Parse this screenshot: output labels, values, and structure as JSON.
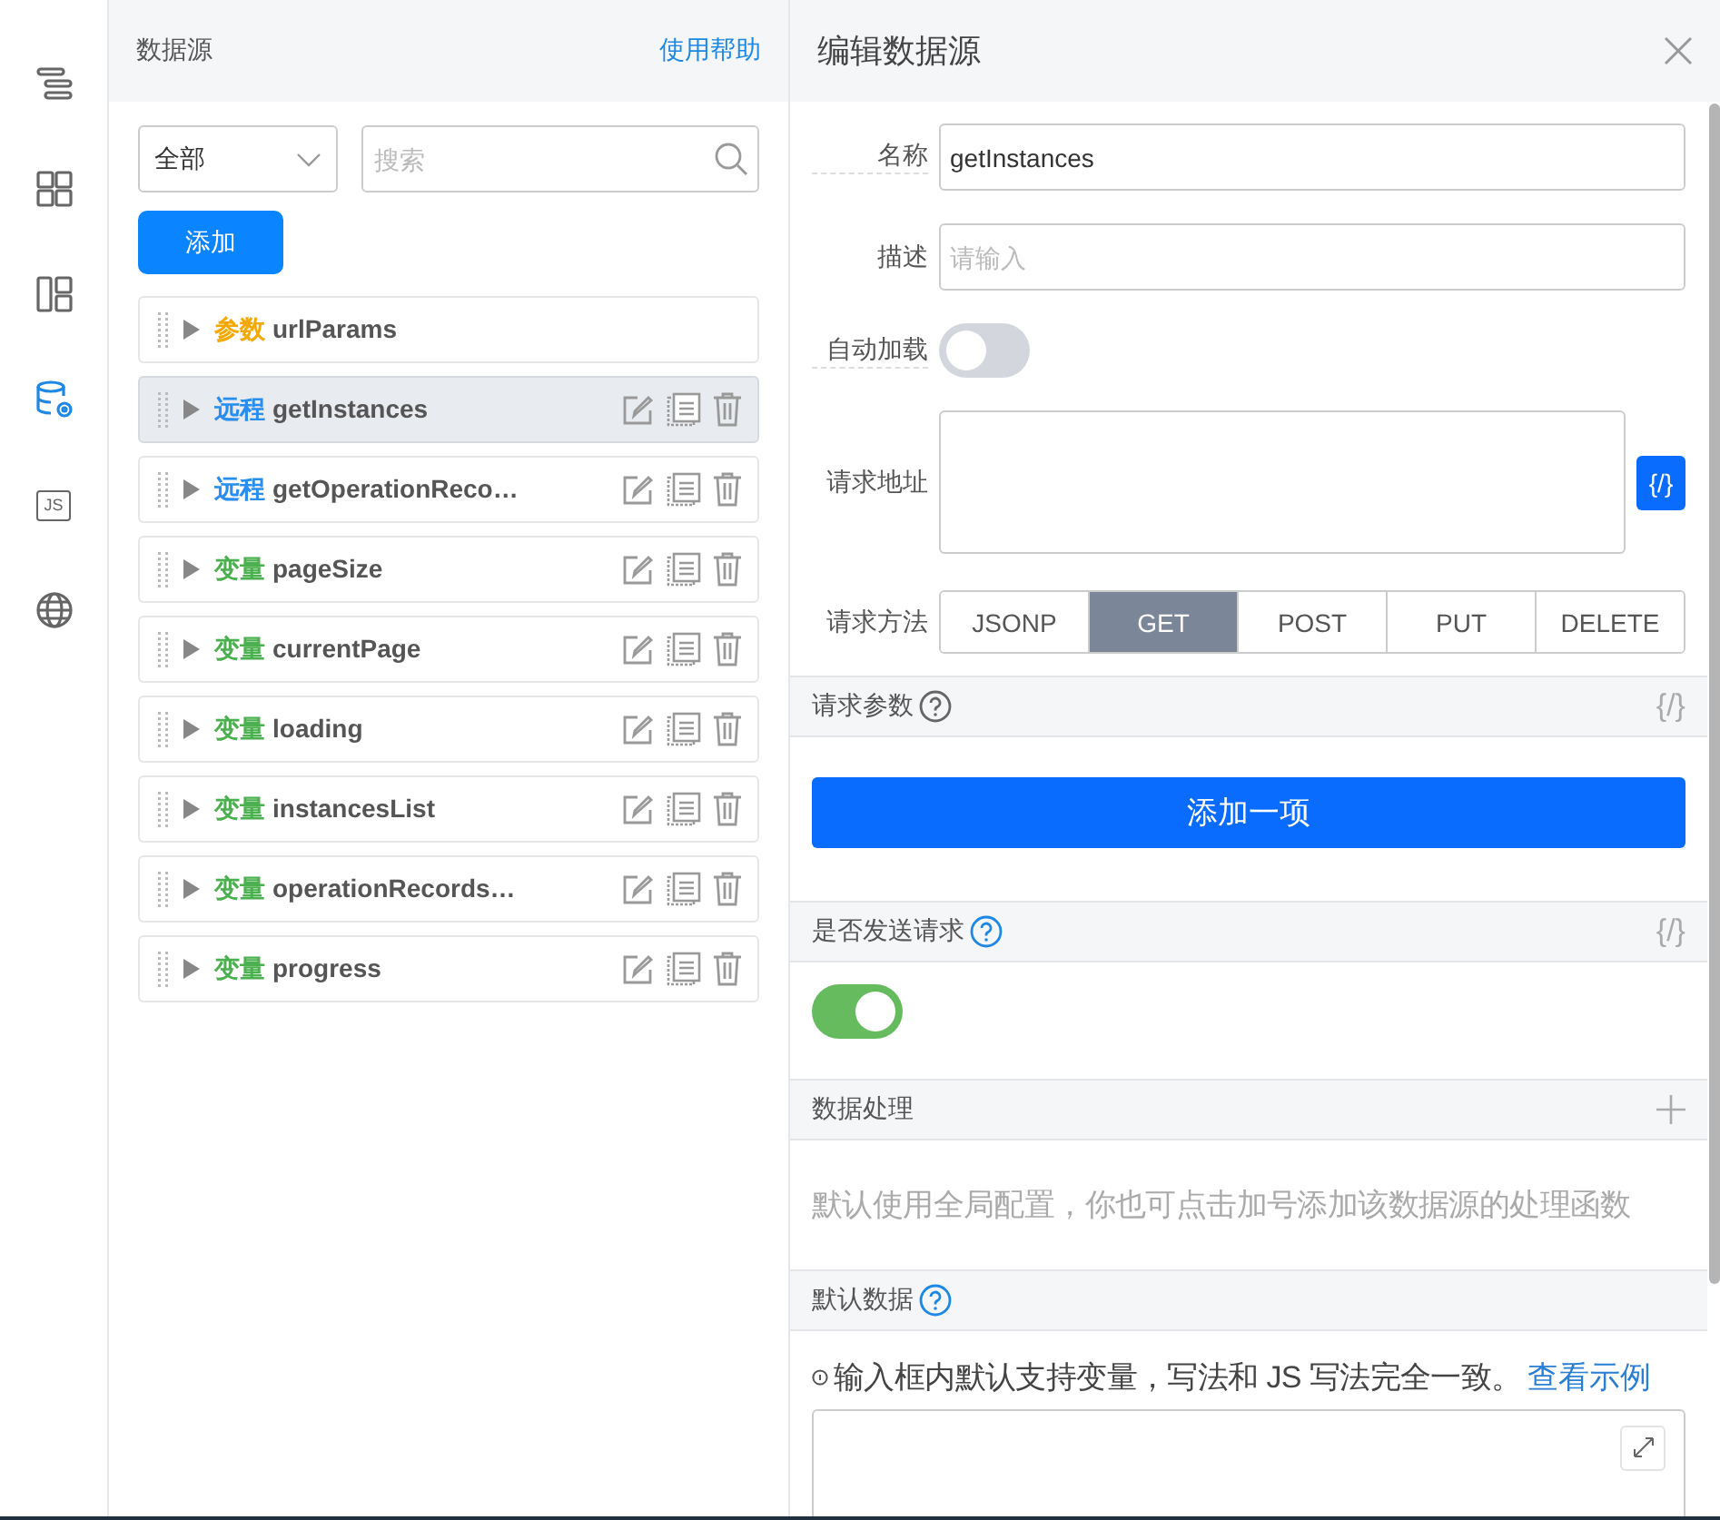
{
  "rail": [
    {
      "kind": "outline",
      "selected": false
    },
    {
      "kind": "grid",
      "selected": false
    },
    {
      "kind": "layout",
      "selected": false
    },
    {
      "kind": "database",
      "selected": true
    },
    {
      "kind": "js",
      "label": "JS",
      "selected": false
    },
    {
      "kind": "globe",
      "selected": false
    }
  ],
  "list_panel": {
    "title": "数据源",
    "help_link": "使用帮助",
    "filter": "全部",
    "search_placeholder": "搜索",
    "add_button": "添加",
    "items": [
      {
        "kind": "param",
        "tag": "参数",
        "name": "urlParams",
        "selected": false,
        "editable": false
      },
      {
        "kind": "remote",
        "tag": "远程",
        "name": "getInstances",
        "selected": true,
        "editable": true
      },
      {
        "kind": "remote",
        "tag": "远程",
        "name": "getOperationReco…",
        "selected": false,
        "editable": true
      },
      {
        "kind": "variable",
        "tag": "变量",
        "name": "pageSize",
        "selected": false,
        "editable": true
      },
      {
        "kind": "variable",
        "tag": "变量",
        "name": "currentPage",
        "selected": false,
        "editable": true
      },
      {
        "kind": "variable",
        "tag": "变量",
        "name": "loading",
        "selected": false,
        "editable": true
      },
      {
        "kind": "variable",
        "tag": "变量",
        "name": "instancesList",
        "selected": false,
        "editable": true
      },
      {
        "kind": "variable",
        "tag": "变量",
        "name": "operationRecords…",
        "selected": false,
        "editable": true
      },
      {
        "kind": "variable",
        "tag": "变量",
        "name": "progress",
        "selected": false,
        "editable": true
      }
    ]
  },
  "editor": {
    "title": "编辑数据源",
    "name_label": "名称",
    "name_value": "getInstances",
    "desc_label": "描述",
    "desc_placeholder": "请输入",
    "auto_load_label": "自动加载",
    "auto_load": {
      "on": false
    },
    "url_label": "请求地址",
    "url_code_button": "{/}",
    "method_label": "请求方法",
    "methods": [
      {
        "label": "JSONP",
        "selected": false
      },
      {
        "label": "GET",
        "selected": true
      },
      {
        "label": "POST",
        "selected": false
      },
      {
        "label": "PUT",
        "selected": false
      },
      {
        "label": "DELETE",
        "selected": false
      }
    ],
    "params_section": {
      "title": "请求参数",
      "code_toggle": "{/}",
      "add_button": "添加一项"
    },
    "send_section": {
      "title": "是否发送请求",
      "code_toggle": "{/}",
      "on": true
    },
    "process_section": {
      "title": "数据处理",
      "hint": "默认使用全局配置，你也可点击加号添加该数据源的处理函数"
    },
    "default_section": {
      "title": "默认数据",
      "note": "输入框内默认支持变量，写法和 JS 写法完全一致。",
      "example_link": "查看示例"
    }
  }
}
